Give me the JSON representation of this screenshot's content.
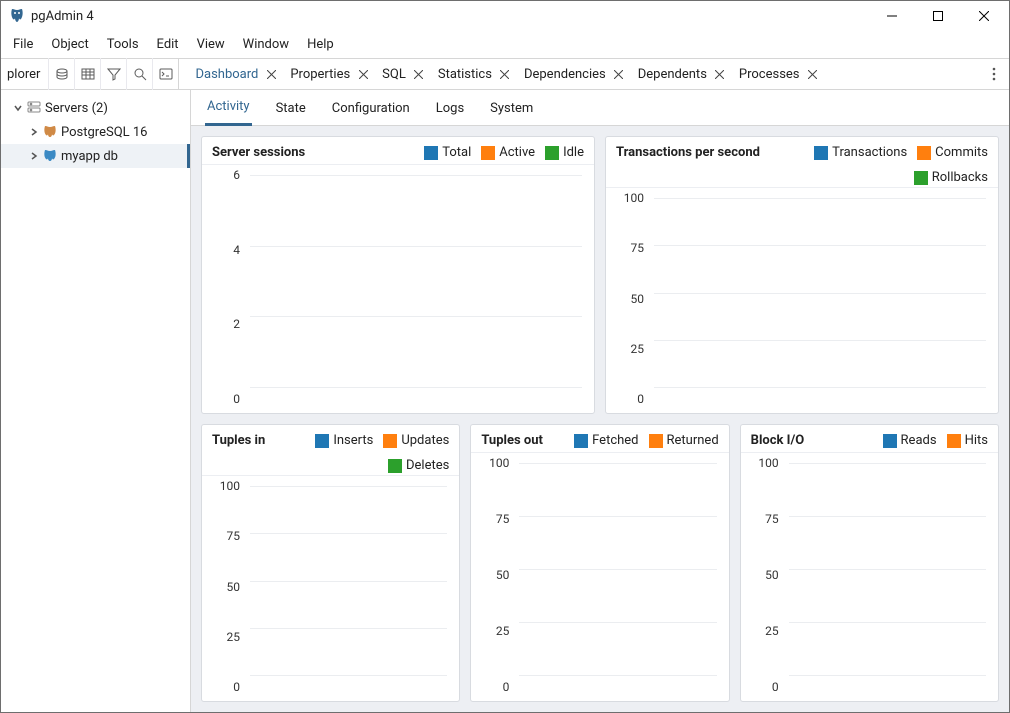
{
  "app_title": "pgAdmin 4",
  "menu": [
    "File",
    "Object",
    "Tools",
    "Edit",
    "View",
    "Window",
    "Help"
  ],
  "side_header_label": "plorer",
  "main_tabs": [
    "Dashboard",
    "Properties",
    "SQL",
    "Statistics",
    "Dependencies",
    "Dependents",
    "Processes"
  ],
  "main_tab_active": "Dashboard",
  "sub_tabs": [
    "Activity",
    "State",
    "Configuration",
    "Logs",
    "System"
  ],
  "sub_tab_active": "Activity",
  "tree": {
    "root": {
      "label": "Servers (2)"
    },
    "n1": {
      "label": "PostgreSQL 16"
    },
    "n2": {
      "label": "myapp db"
    }
  },
  "colors": {
    "blue": "#1f77b4",
    "orange": "#ff7f0e",
    "green": "#2ca02c"
  },
  "chart_data": [
    {
      "id": "c0",
      "title": "Server sessions",
      "type": "line",
      "yticks": [
        6,
        4,
        2,
        0
      ],
      "ylim": [
        0,
        6
      ],
      "series": [
        {
          "name": "Total",
          "color": "blue",
          "values": []
        },
        {
          "name": "Active",
          "color": "orange",
          "values": []
        },
        {
          "name": "Idle",
          "color": "green",
          "values": []
        }
      ]
    },
    {
      "id": "c1",
      "title": "Transactions per second",
      "type": "line",
      "yticks": [
        100,
        75,
        50,
        25,
        0
      ],
      "ylim": [
        0,
        100
      ],
      "series": [
        {
          "name": "Transactions",
          "color": "blue",
          "values": []
        },
        {
          "name": "Commits",
          "color": "orange",
          "values": []
        },
        {
          "name": "Rollbacks",
          "color": "green",
          "values": []
        }
      ]
    },
    {
      "id": "c2",
      "title": "Tuples in",
      "type": "line",
      "yticks": [
        100,
        75,
        50,
        25,
        0
      ],
      "ylim": [
        0,
        100
      ],
      "series": [
        {
          "name": "Inserts",
          "color": "blue",
          "values": []
        },
        {
          "name": "Updates",
          "color": "orange",
          "values": []
        },
        {
          "name": "Deletes",
          "color": "green",
          "values": []
        }
      ]
    },
    {
      "id": "c3",
      "title": "Tuples out",
      "type": "line",
      "yticks": [
        100,
        75,
        50,
        25,
        0
      ],
      "ylim": [
        0,
        100
      ],
      "series": [
        {
          "name": "Fetched",
          "color": "blue",
          "values": []
        },
        {
          "name": "Returned",
          "color": "orange",
          "values": []
        }
      ]
    },
    {
      "id": "c4",
      "title": "Block I/O",
      "type": "line",
      "yticks": [
        100,
        75,
        50,
        25,
        0
      ],
      "ylim": [
        0,
        100
      ],
      "series": [
        {
          "name": "Reads",
          "color": "blue",
          "values": []
        },
        {
          "name": "Hits",
          "color": "orange",
          "values": []
        }
      ]
    }
  ]
}
